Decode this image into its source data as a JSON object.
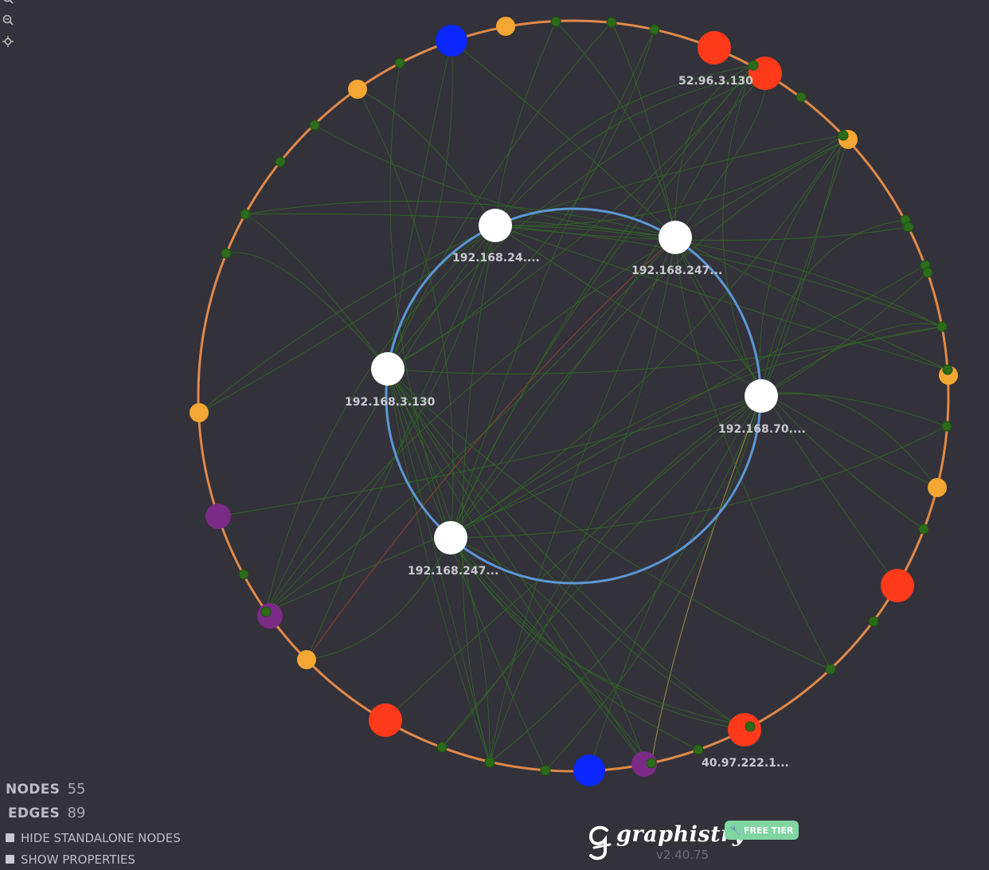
{
  "colors": {
    "background": "#333139",
    "outer_ring": "#e0894a",
    "inner_ring": "#5b97d6",
    "edge": "#2f6a24",
    "edge_arrow": "#3d8a2e",
    "node_white": "#ffffff",
    "node_orange": "#f5a733",
    "node_red": "#ff3a1a",
    "node_blue": "#0a27ff",
    "node_purple": "#7b2a86",
    "node_green": "#2b6b1a",
    "free_tier": "#7fd6a0"
  },
  "toolbar": {
    "icons": [
      "zoom-in-icon",
      "zoom-out-icon",
      "center-icon"
    ]
  },
  "graph": {
    "labels": {
      "ip_52_96": "52.96.3.130",
      "ip_inner_1": "192.168.24....",
      "ip_inner_2": "192.168.247...",
      "ip_inner_3": "192.168.3.130",
      "ip_inner_4": "192.168.70....",
      "ip_inner_5": "192.168.247...",
      "ip_40_97": "40.97.222.1..."
    },
    "nodes": [
      {
        "id": "w1",
        "color": "white",
        "label_key": "ip_inner_1"
      },
      {
        "id": "w2",
        "color": "white",
        "label_key": "ip_inner_2"
      },
      {
        "id": "w3",
        "color": "white",
        "label_key": "ip_inner_3"
      },
      {
        "id": "w4",
        "color": "white",
        "label_key": "ip_inner_4"
      },
      {
        "id": "w5",
        "color": "white",
        "label_key": "ip_inner_5"
      },
      {
        "id": "r1",
        "color": "red",
        "label_key": ""
      },
      {
        "id": "r2",
        "color": "red",
        "label_key": "ip_52_96"
      },
      {
        "id": "r3",
        "color": "red",
        "label_key": ""
      },
      {
        "id": "r4",
        "color": "red",
        "label_key": ""
      },
      {
        "id": "r5",
        "color": "red",
        "label_key": "ip_40_97"
      },
      {
        "id": "b1",
        "color": "blue",
        "label_key": ""
      },
      {
        "id": "b2",
        "color": "blue",
        "label_key": ""
      },
      {
        "id": "p1",
        "color": "purple",
        "label_key": ""
      },
      {
        "id": "p2",
        "color": "purple",
        "label_key": ""
      },
      {
        "id": "p3",
        "color": "purple",
        "label_key": ""
      },
      {
        "id": "o1",
        "color": "orange",
        "label_key": ""
      },
      {
        "id": "o2",
        "color": "orange",
        "label_key": ""
      },
      {
        "id": "o3",
        "color": "orange",
        "label_key": ""
      },
      {
        "id": "o4",
        "color": "orange",
        "label_key": ""
      },
      {
        "id": "o5",
        "color": "orange",
        "label_key": ""
      },
      {
        "id": "o6",
        "color": "orange",
        "label_key": ""
      },
      {
        "id": "o7",
        "color": "orange",
        "label_key": ""
      }
    ]
  },
  "stats": {
    "nodes_label": "NODES",
    "nodes_value": "55",
    "edges_label": "EDGES",
    "edges_value": "89"
  },
  "options": {
    "hide_standalone": "HIDE STANDALONE NODES",
    "show_properties": "SHOW PROPERTIES"
  },
  "brand": {
    "name": "graphistry",
    "version": "v2.40.75",
    "tier": "FREE TIER"
  }
}
